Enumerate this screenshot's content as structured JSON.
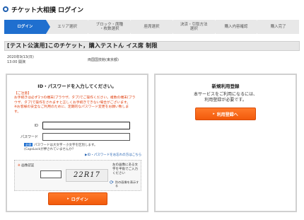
{
  "header": {
    "title": "チケット大相撲 ログイン"
  },
  "steps": [
    {
      "label": "ログイン",
      "active": true
    },
    {
      "label": "エリア選択",
      "active": false
    },
    {
      "label": "ブロック・席種\n・枚数選択",
      "active": false
    },
    {
      "label": "座席選択",
      "active": false
    },
    {
      "label": "決済・引取方法\n選択",
      "active": false
    },
    {
      "label": "購入内容確認",
      "active": false
    },
    {
      "label": "購入完了",
      "active": false
    }
  ],
  "event": {
    "title": "[テスト公演用]このチケット，購入テストん イス席 制限",
    "date_line1": "2020年9/13(日)",
    "date_line2": "13:00 開演",
    "venue": "両国国技館(東京都)"
  },
  "login": {
    "title": "ID・パスワードを入力してください。",
    "notice_title": "【ご注意】",
    "notice_lines": [
      "お手続きは必ず1つの端末(ブラウザ、タブ)でご操作ください。複数の端末(ブラ",
      "ウザ、タブ)で操作をされますと正しくお手続きできない場合がございます。",
      "※お客様の安全なご利用のために、定期的なパスワード変更をお願い致しま",
      "す。"
    ],
    "id_label": "ID",
    "id_value": "",
    "password_label": "パスワード",
    "password_value": "",
    "pw_badge": "必須",
    "pw_note_1": "パスワードは大文字・小文字を区別します。",
    "pw_note_2": "(CapsLockが押されていませんか？",
    "forgot_link": "▶ID・パスワードをお忘れの方はこちら",
    "captcha_label_mark": "※",
    "captcha_label": "画像認証",
    "captcha_value": "",
    "captcha_image_text": "22R17",
    "captcha_help": "左の画像にある文字を半角でご入力ください",
    "captcha_refresh": "別の画像を表示する",
    "login_button": "ログイン",
    "button_arrow": "▸"
  },
  "register": {
    "title": "新規利用登録",
    "text_line1": "本サービスをご利用になるには、",
    "text_line2": "利用登録が必要です。",
    "button": "利用登録へ",
    "button_arrow": "▸"
  }
}
